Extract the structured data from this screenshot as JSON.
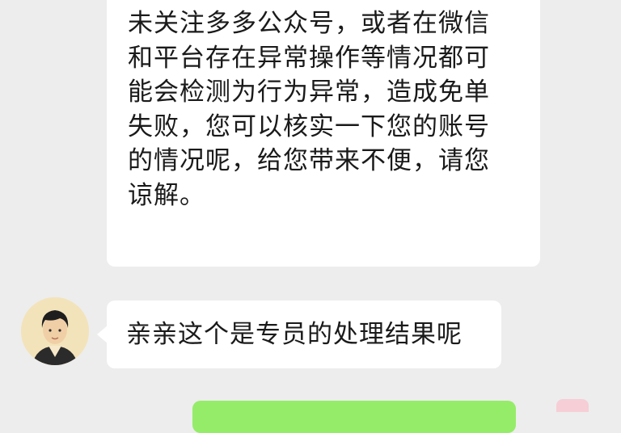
{
  "colors": {
    "background": "#ededed",
    "bubble_received": "#ffffff",
    "bubble_sent": "#95ec69",
    "avatar_bg": "#f3e3ba",
    "text": "#1a1a1a"
  },
  "messages": [
    {
      "side": "left",
      "lines": [
        "未关注多多公众号，或者在微信",
        "和平台存在异常操作等情况都可",
        "能会检测为行为异常，造成免单",
        "失败，您可以核实一下您的账号",
        "的情况呢，给您带来不便，请您",
        "谅解。"
      ]
    },
    {
      "side": "left",
      "text": "亲亲这个是专员的处理结果呢",
      "avatar": "agent-avatar"
    },
    {
      "side": "right",
      "text": ""
    }
  ]
}
